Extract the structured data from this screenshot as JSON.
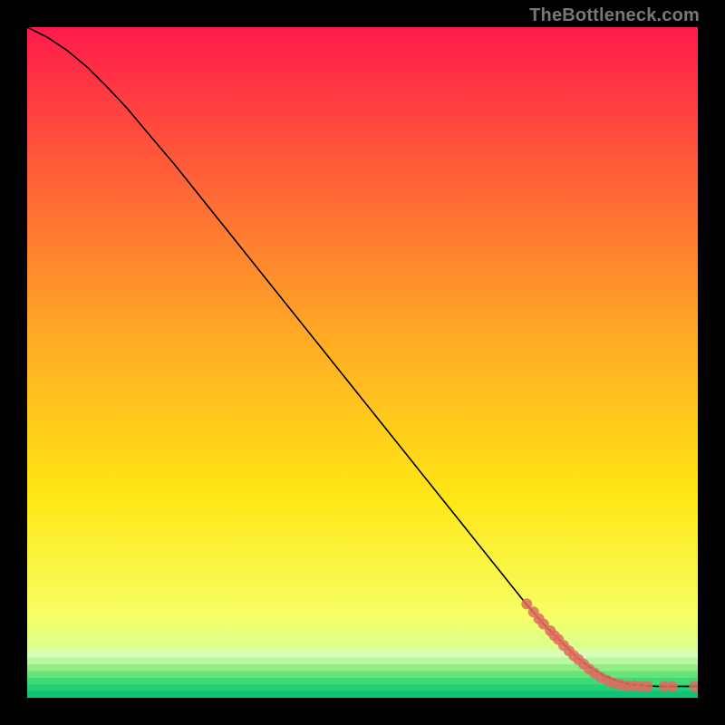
{
  "watermark": "TheBottleneck.com",
  "chart_data": {
    "type": "line",
    "title": "",
    "xlabel": "",
    "ylabel": "",
    "xlim": [
      0,
      100
    ],
    "ylim": [
      0,
      100
    ],
    "grid": false,
    "legend": false,
    "background_gradient": {
      "stops": [
        {
          "pct": 0,
          "color": "#ff1a4b"
        },
        {
          "pct": 20,
          "color": "#ff5a3a"
        },
        {
          "pct": 45,
          "color": "#ffa726"
        },
        {
          "pct": 70,
          "color": "#ffe714"
        },
        {
          "pct": 88,
          "color": "#f6ff66"
        },
        {
          "pct": 96,
          "color": "#c7ffb0"
        },
        {
          "pct": 100,
          "color": "#1bd97a"
        }
      ]
    },
    "green_bands": [
      {
        "pct": 93,
        "color": "#d7ffb8"
      },
      {
        "pct": 94,
        "color": "#b7f7a0"
      },
      {
        "pct": 95,
        "color": "#8fee86"
      },
      {
        "pct": 96,
        "color": "#68e37a"
      },
      {
        "pct": 97,
        "color": "#40d978"
      },
      {
        "pct": 98,
        "color": "#22ce76"
      },
      {
        "pct": 99,
        "color": "#0fc374"
      }
    ],
    "series": [
      {
        "name": "curve",
        "x": [
          0,
          3,
          6,
          9,
          12,
          15,
          18,
          22,
          26,
          30,
          34,
          38,
          42,
          46,
          50,
          54,
          58,
          62,
          66,
          70,
          74,
          77,
          80,
          82,
          84,
          86,
          88,
          90,
          92,
          94,
          96,
          98,
          100
        ],
        "y": [
          100,
          98.5,
          96.5,
          94,
          91,
          87.8,
          84.2,
          79.5,
          74.5,
          69.5,
          64.5,
          59.5,
          54.5,
          49.5,
          44.5,
          39.5,
          34.5,
          29.5,
          24.5,
          19.5,
          14.5,
          11,
          8,
          6,
          4.5,
          3.3,
          2.5,
          2,
          1.8,
          1.7,
          1.7,
          1.7,
          1.7
        ]
      }
    ],
    "points": [
      {
        "x": 74.5,
        "y": 14.0
      },
      {
        "x": 75.5,
        "y": 12.8
      },
      {
        "x": 76.3,
        "y": 11.8
      },
      {
        "x": 77.0,
        "y": 11.0
      },
      {
        "x": 78.0,
        "y": 10.0
      },
      {
        "x": 78.6,
        "y": 9.3
      },
      {
        "x": 79.2,
        "y": 8.7
      },
      {
        "x": 80.0,
        "y": 7.8
      },
      {
        "x": 80.8,
        "y": 7.0
      },
      {
        "x": 81.5,
        "y": 6.3
      },
      {
        "x": 82.2,
        "y": 5.7
      },
      {
        "x": 83.0,
        "y": 5.0
      },
      {
        "x": 83.8,
        "y": 4.3
      },
      {
        "x": 84.6,
        "y": 3.7
      },
      {
        "x": 85.5,
        "y": 3.1
      },
      {
        "x": 86.5,
        "y": 2.6
      },
      {
        "x": 87.5,
        "y": 2.2
      },
      {
        "x": 88.5,
        "y": 2.0
      },
      {
        "x": 89.5,
        "y": 1.8
      },
      {
        "x": 90.5,
        "y": 1.8
      },
      {
        "x": 91.5,
        "y": 1.7
      },
      {
        "x": 92.5,
        "y": 1.7
      },
      {
        "x": 95.0,
        "y": 1.7
      },
      {
        "x": 96.2,
        "y": 1.7
      },
      {
        "x": 99.5,
        "y": 1.7
      }
    ]
  }
}
